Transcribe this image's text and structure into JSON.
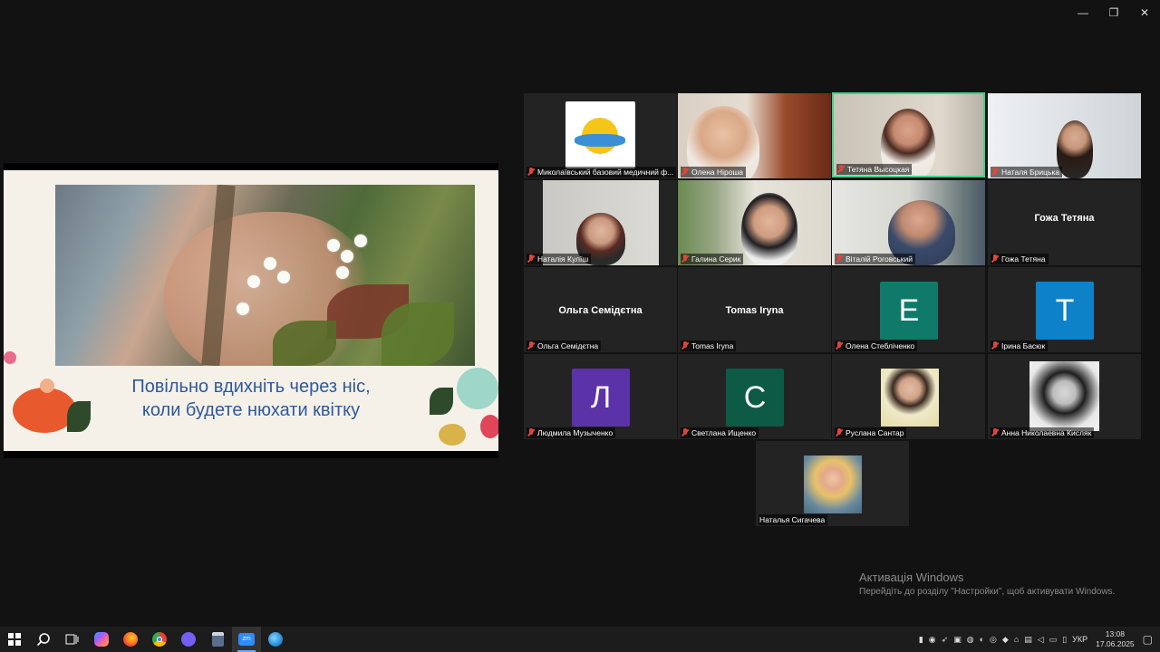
{
  "window_controls": {
    "minimize": "—",
    "maximize": "❐",
    "close": "✕"
  },
  "slide": {
    "caption_line1": "Повільно вдихніть через ніс,",
    "caption_line2": "коли будете нюхати квітку"
  },
  "tiles": [
    {
      "name": "Миколаївський базовий медичний ф...",
      "kind": "logo"
    },
    {
      "name": "Олена Ніроша",
      "kind": "video"
    },
    {
      "name": "Тетяна Высоцкая",
      "kind": "video",
      "active": true
    },
    {
      "name": "Наталя Брицька",
      "kind": "video"
    },
    {
      "name": "Наталія Кулїш",
      "kind": "video"
    },
    {
      "name": "Галина Серик",
      "kind": "video"
    },
    {
      "name": "Віталій Роговський",
      "kind": "video"
    },
    {
      "name": "Гожа Тетяна",
      "kind": "text",
      "display": "Гожа Тетяна"
    },
    {
      "name": "Ольга Семідєтна",
      "kind": "text",
      "display": "Ольга Семідєтна"
    },
    {
      "name": "Tomas Iryna",
      "kind": "text",
      "display": "Tomas Iryna"
    },
    {
      "name": "Олена Стебліченко",
      "kind": "letter",
      "letter": "Е",
      "color": "#0f7a6a"
    },
    {
      "name": "Ірина Басюк",
      "kind": "letter",
      "letter": "Т",
      "color": "#0e82c9"
    },
    {
      "name": "Людмила Музыченко",
      "kind": "letter",
      "letter": "Л",
      "color": "#5b32a8"
    },
    {
      "name": "Светлана Ищенко",
      "kind": "letter",
      "letter": "С",
      "color": "#0d5a45"
    },
    {
      "name": "Руслана Сантар",
      "kind": "photo"
    },
    {
      "name": "Анна Николаевна Кисляк",
      "kind": "photo"
    },
    {
      "name": "Наталья Сигачева",
      "kind": "photo"
    }
  ],
  "watermark": {
    "title": "Активація Windows",
    "subtitle": "Перейдіть до розділу \"Настройки\", щоб активувати Windows."
  },
  "taskbar": {
    "apps": [
      "start-icon",
      "search-icon",
      "task-view-icon",
      "copilot-icon",
      "firefox-icon",
      "chrome-icon",
      "viber-icon",
      "calculator-icon",
      "zoom-icon",
      "browser-icon"
    ],
    "zoom_label": "zm",
    "language": "УКР",
    "time": "13:08",
    "date": "17.06.2025"
  }
}
